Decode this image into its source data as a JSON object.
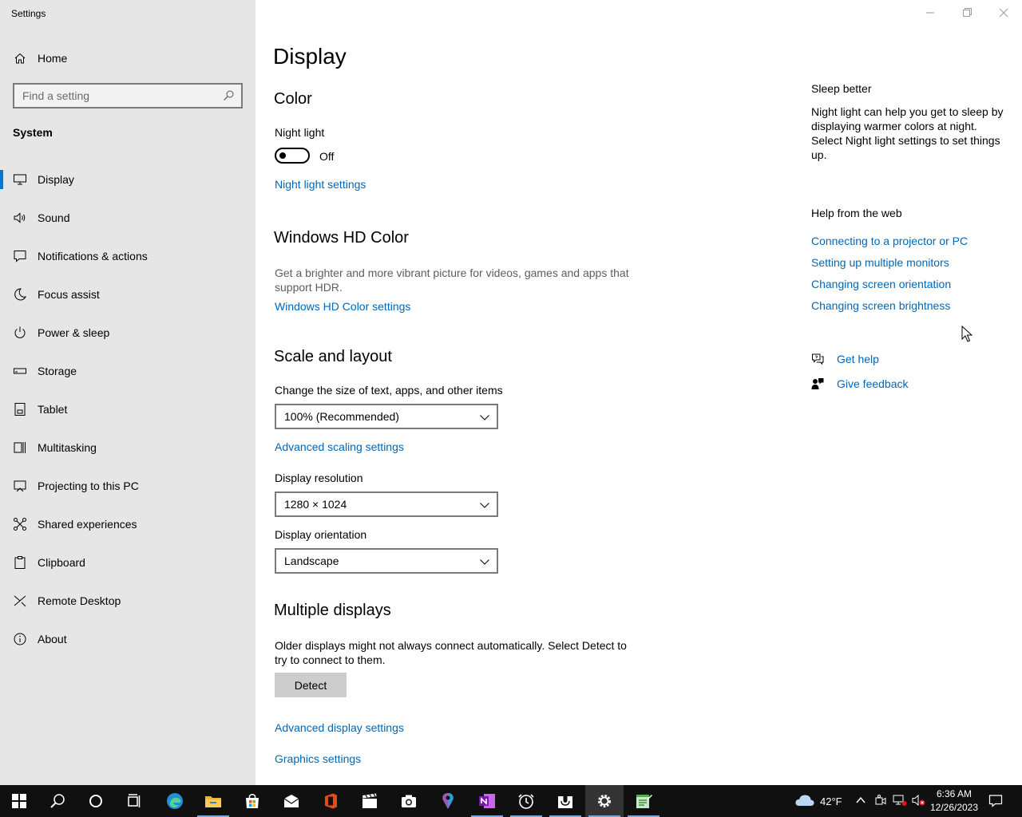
{
  "window": {
    "title": "Settings"
  },
  "sidebar": {
    "home_label": "Home",
    "search_placeholder": "Find a setting",
    "section": "System",
    "items": [
      {
        "label": "Display",
        "icon": "monitor-icon",
        "active": true
      },
      {
        "label": "Sound",
        "icon": "speaker-icon"
      },
      {
        "label": "Notifications & actions",
        "icon": "notification-icon"
      },
      {
        "label": "Focus assist",
        "icon": "moon-icon"
      },
      {
        "label": "Power & sleep",
        "icon": "power-icon"
      },
      {
        "label": "Storage",
        "icon": "storage-icon"
      },
      {
        "label": "Tablet",
        "icon": "tablet-icon"
      },
      {
        "label": "Multitasking",
        "icon": "multitasking-icon"
      },
      {
        "label": "Projecting to this PC",
        "icon": "projecting-icon"
      },
      {
        "label": "Shared experiences",
        "icon": "shared-icon"
      },
      {
        "label": "Clipboard",
        "icon": "clipboard-icon"
      },
      {
        "label": "Remote Desktop",
        "icon": "remote-desktop-icon"
      },
      {
        "label": "About",
        "icon": "info-icon"
      }
    ]
  },
  "main": {
    "title": "Display",
    "color": {
      "heading": "Color",
      "night_light_label": "Night light",
      "night_light_state": "Off",
      "night_light_link": "Night light settings"
    },
    "hd_color": {
      "heading": "Windows HD Color",
      "description": "Get a brighter and more vibrant picture for videos, games and apps that support HDR.",
      "link": "Windows HD Color settings"
    },
    "scale": {
      "heading": "Scale and layout",
      "size_label": "Change the size of text, apps, and other items",
      "size_value": "100% (Recommended)",
      "advanced_link": "Advanced scaling settings",
      "resolution_label": "Display resolution",
      "resolution_value": "1280 × 1024",
      "orientation_label": "Display orientation",
      "orientation_value": "Landscape"
    },
    "multiple": {
      "heading": "Multiple displays",
      "description": "Older displays might not always connect automatically. Select Detect to try to connect to them.",
      "detect_label": "Detect",
      "advanced_display_link": "Advanced display settings",
      "graphics_link": "Graphics settings"
    }
  },
  "aside": {
    "sleep_heading": "Sleep better",
    "sleep_text": "Night light can help you get to sleep by displaying warmer colors at night. Select Night light settings to set things up.",
    "help_heading": "Help from the web",
    "help_links": [
      "Connecting to a projector or PC",
      "Setting up multiple monitors",
      "Changing screen orientation",
      "Changing screen brightness"
    ],
    "get_help": "Get help",
    "give_feedback": "Give feedback"
  },
  "taskbar": {
    "weather": "42°F",
    "time": "6:36 AM",
    "date": "12/26/2023"
  },
  "colors": {
    "accent": "#0078d7",
    "link": "#0067b8",
    "sidebar_bg": "#e6e6e6",
    "taskbar_bg": "#101010"
  }
}
